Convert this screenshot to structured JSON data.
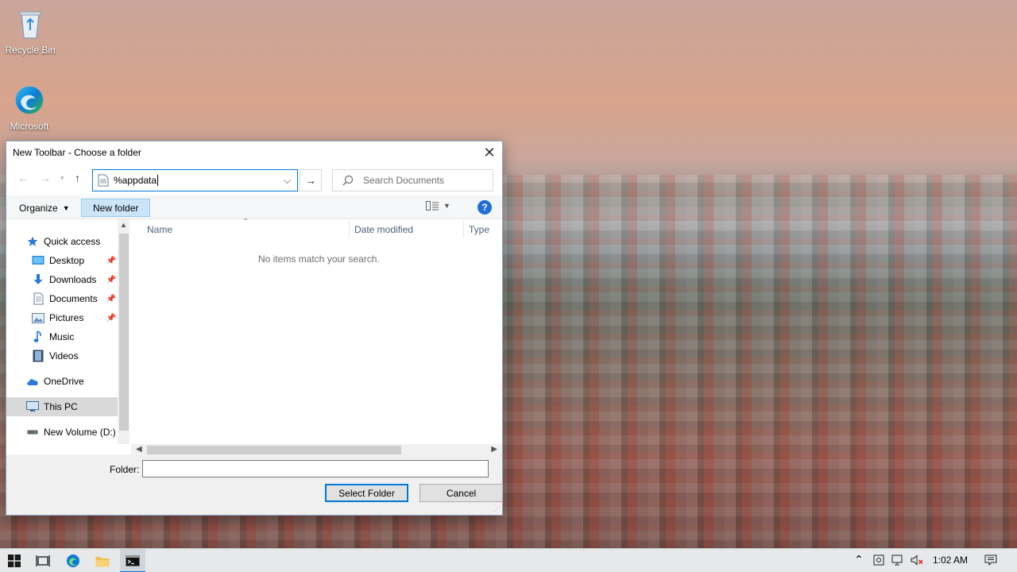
{
  "desktop": {
    "icons": [
      {
        "label": "Recycle Bin",
        "icon": "recycle-bin-icon"
      },
      {
        "label": "Microsoft",
        "icon": "edge-icon"
      }
    ]
  },
  "dialog": {
    "title": "New Toolbar - Choose a folder",
    "close_glyph": "✕",
    "address": {
      "value": "%appdata"
    },
    "search": {
      "placeholder": "Search Documents"
    },
    "toolbar": {
      "organize": "Organize",
      "new_folder": "New folder",
      "help": "?"
    },
    "nav": {
      "items": [
        {
          "label": "Quick access",
          "icon": "star-icon",
          "pinned": false
        },
        {
          "label": "Desktop",
          "icon": "desktop-folder-icon",
          "pinned": true
        },
        {
          "label": "Downloads",
          "icon": "download-arrow-icon",
          "pinned": true
        },
        {
          "label": "Documents",
          "icon": "documents-icon",
          "pinned": true
        },
        {
          "label": "Pictures",
          "icon": "pictures-icon",
          "pinned": true
        },
        {
          "label": "Music",
          "icon": "music-note-icon",
          "pinned": false
        },
        {
          "label": "Videos",
          "icon": "video-film-icon",
          "pinned": false
        },
        {
          "label": "OneDrive",
          "icon": "cloud-icon",
          "pinned": false
        },
        {
          "label": "This PC",
          "icon": "computer-icon",
          "pinned": false,
          "selected": true
        },
        {
          "label": "New Volume (D:)",
          "icon": "drive-icon",
          "pinned": false
        }
      ]
    },
    "columns": {
      "name": "Name",
      "date_modified": "Date modified",
      "type": "Type"
    },
    "empty_message": "No items match your search.",
    "footer": {
      "folder_label": "Folder:",
      "folder_value": "",
      "select_button": "Select Folder",
      "cancel_button": "Cancel"
    }
  },
  "taskbar": {
    "clock": "1:02 AM",
    "accent": "#0078d7"
  }
}
